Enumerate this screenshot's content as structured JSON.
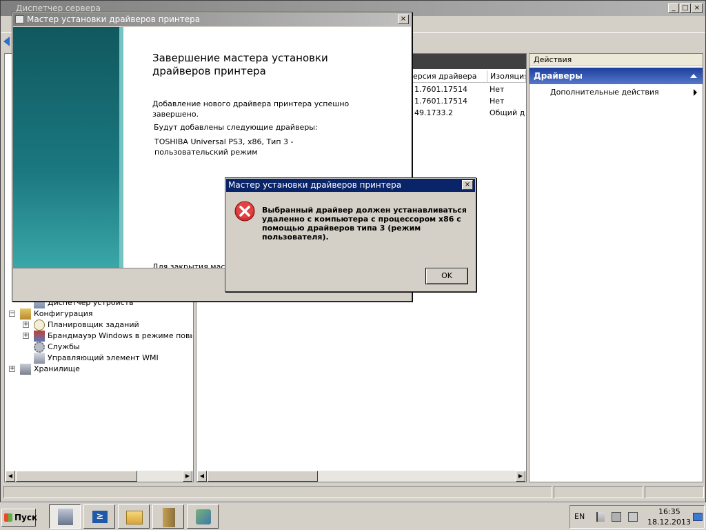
{
  "main_window": {
    "title": "Диспетчер сервера"
  },
  "tree": {
    "items": [
      {
        "label": "Диспетчер устройств",
        "icon": "device-manager-icon"
      },
      {
        "label": "Конфигурация",
        "icon": "configuration-icon",
        "expander": "−"
      },
      {
        "label": "Планировщик заданий",
        "icon": "clock-icon",
        "expander": "+"
      },
      {
        "label": "Брандмауэр Windows в режиме повышенн",
        "icon": "firewall-icon",
        "expander": "+"
      },
      {
        "label": "Службы",
        "icon": "gear-icon"
      },
      {
        "label": "Управляющий элемент WMI",
        "icon": "wmi-icon"
      },
      {
        "label": "Хранилище",
        "icon": "storage-icon",
        "expander": "+"
      }
    ]
  },
  "center": {
    "columns": [
      "ерсия драйвера",
      "Изоляция"
    ],
    "rows": [
      {
        "version": "1.7601.17514",
        "isolation": "Нет"
      },
      {
        "version": "1.7601.17514",
        "isolation": "Нет"
      },
      {
        "version": "49.1733.2",
        "isolation": "Общий до"
      }
    ]
  },
  "actions": {
    "title": "Действия",
    "group": "Драйверы",
    "more": "Дополнительные действия"
  },
  "wizard": {
    "title": "Мастер установки драйверов принтера",
    "heading": "Завершение мастера установки драйверов принтера",
    "success": "Добавление нового драйвера принтера успешно завершено.",
    "drivers_label": "Будут добавлены следующие драйверы:",
    "driver": "TOSHIBA Universal PS3, x86, Тип 3 - пользовательский режим",
    "close_hint": "Для закрытия масте"
  },
  "error_dialog": {
    "title": "Мастер установки драйверов принтера",
    "message": "Выбранный драйвер должен устанавливаться удаленно с компьютера с процессором x86 с помощью драйверов типа 3 (режим пользователя).",
    "ok": "OK"
  },
  "taskbar": {
    "start": "Пуск",
    "language": "EN",
    "time": "16:35",
    "date": "18.12.2013"
  },
  "colors": {
    "error_red": "#d62f2f",
    "dialog_title": "#0a246a"
  }
}
